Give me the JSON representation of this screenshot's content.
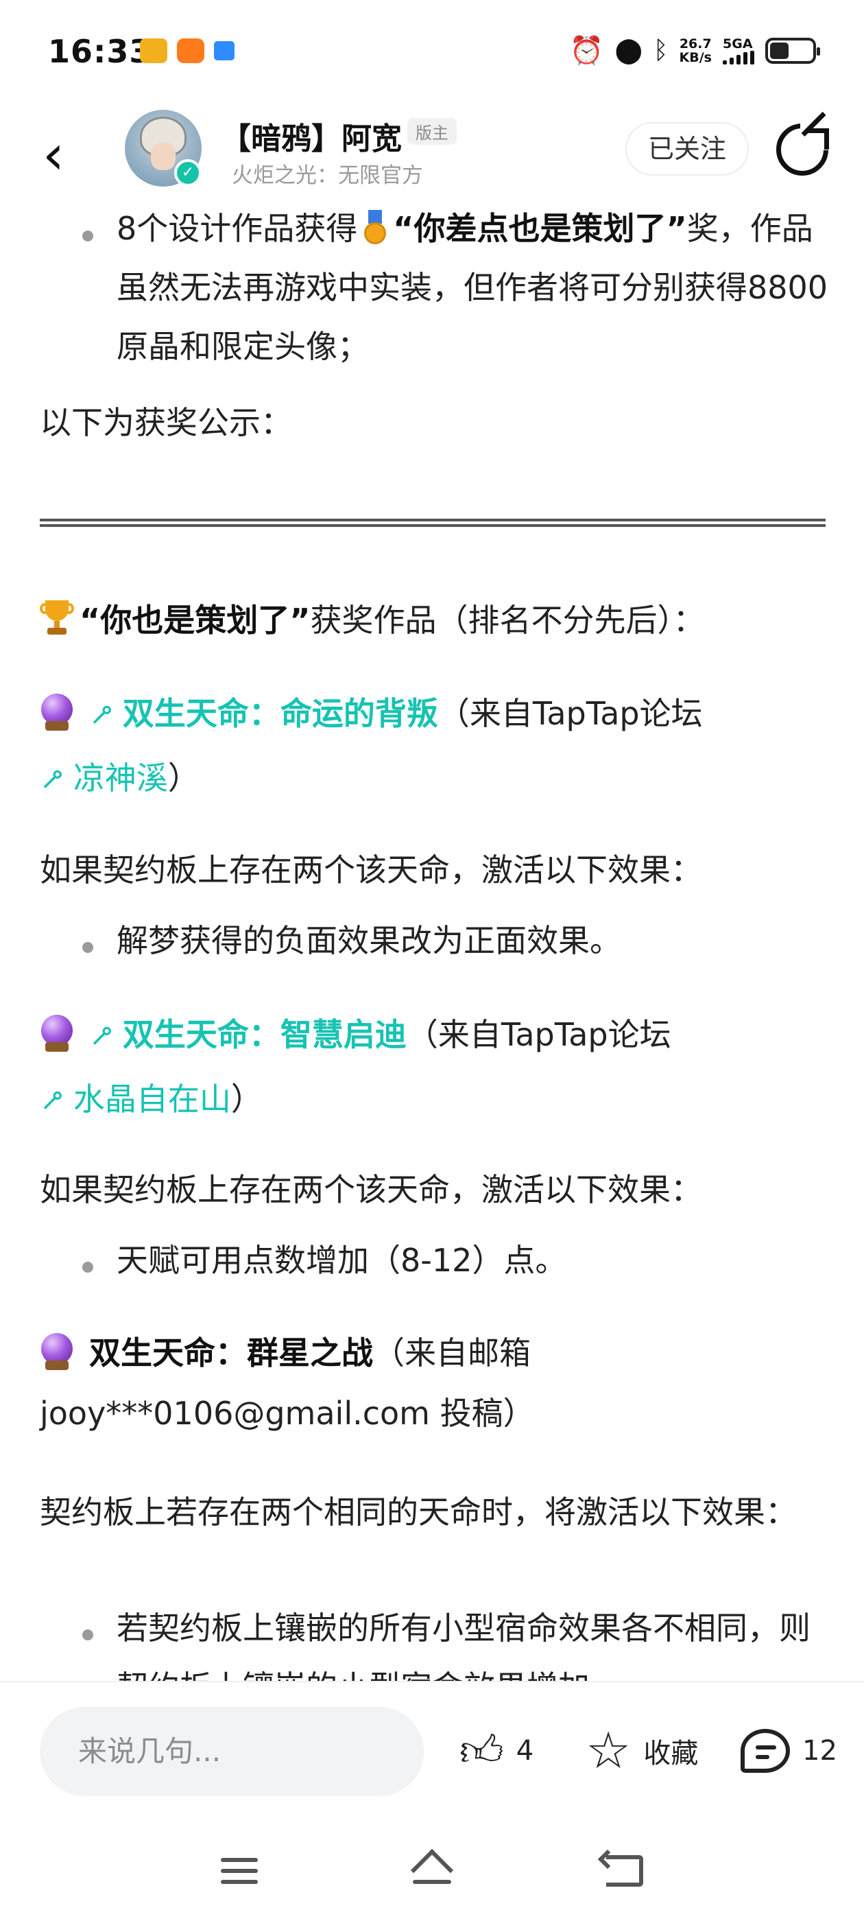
{
  "status_bar": {
    "time": "16:33",
    "net_speed_value": "26.7",
    "net_speed_unit": "KB/s",
    "net_type": "5GA",
    "battery_level": 0.45
  },
  "header": {
    "author_name": "【暗鸦】阿宽",
    "badge": "版主",
    "subtitle": "火炬之光：无限官方",
    "follow_label": "已关注"
  },
  "article": {
    "intro_bullet_pre": "8个设计作品获得",
    "intro_bullet_quote": "“你差点也是策划了”",
    "intro_bullet_mid": "奖，作品虽然无法再游戏中实装，但作者将可分别获得8800原晶和限定头像；",
    "announce": "以下为获奖公示：",
    "award_quote": "“你也是策划了”",
    "award_rest": "获奖作品（排名不分先后）：",
    "entries": [
      {
        "title": "双生天命：命运的背叛",
        "source_pre": "（来自TapTap论坛",
        "author": "凉神溪",
        "source_post": "）",
        "desc": "如果契约板上存在两个该天命，激活以下效果：",
        "bullet": "解梦获得的负面效果改为正面效果。"
      },
      {
        "title": "双生天命：智慧启迪",
        "source_pre": "（来自TapTap论坛",
        "author": "水晶自在山",
        "source_post": "）",
        "desc": "如果契约板上存在两个该天命，激活以下效果：",
        "bullet": "天赋可用点数增加（8-12）点。"
      },
      {
        "title": "双生天命：群星之战",
        "source_line1": "（来自邮箱",
        "source_line2": "jooy***0106@gmail.com 投稿）",
        "desc": "契约板上若存在两个相同的天命时，将激活以下效果：",
        "bullet": "若契约板上镶嵌的所有小型宿命效果各不相同，则契约板上镶嵌的小型宿命效果增加"
      }
    ]
  },
  "bottom_bar": {
    "comment_placeholder": "来说几句...",
    "like_count": "4",
    "favorite_label": "收藏",
    "comment_count": "12"
  },
  "colors": {
    "link": "#17c3b2",
    "text": "#222222",
    "verify": "#16c2a8"
  }
}
